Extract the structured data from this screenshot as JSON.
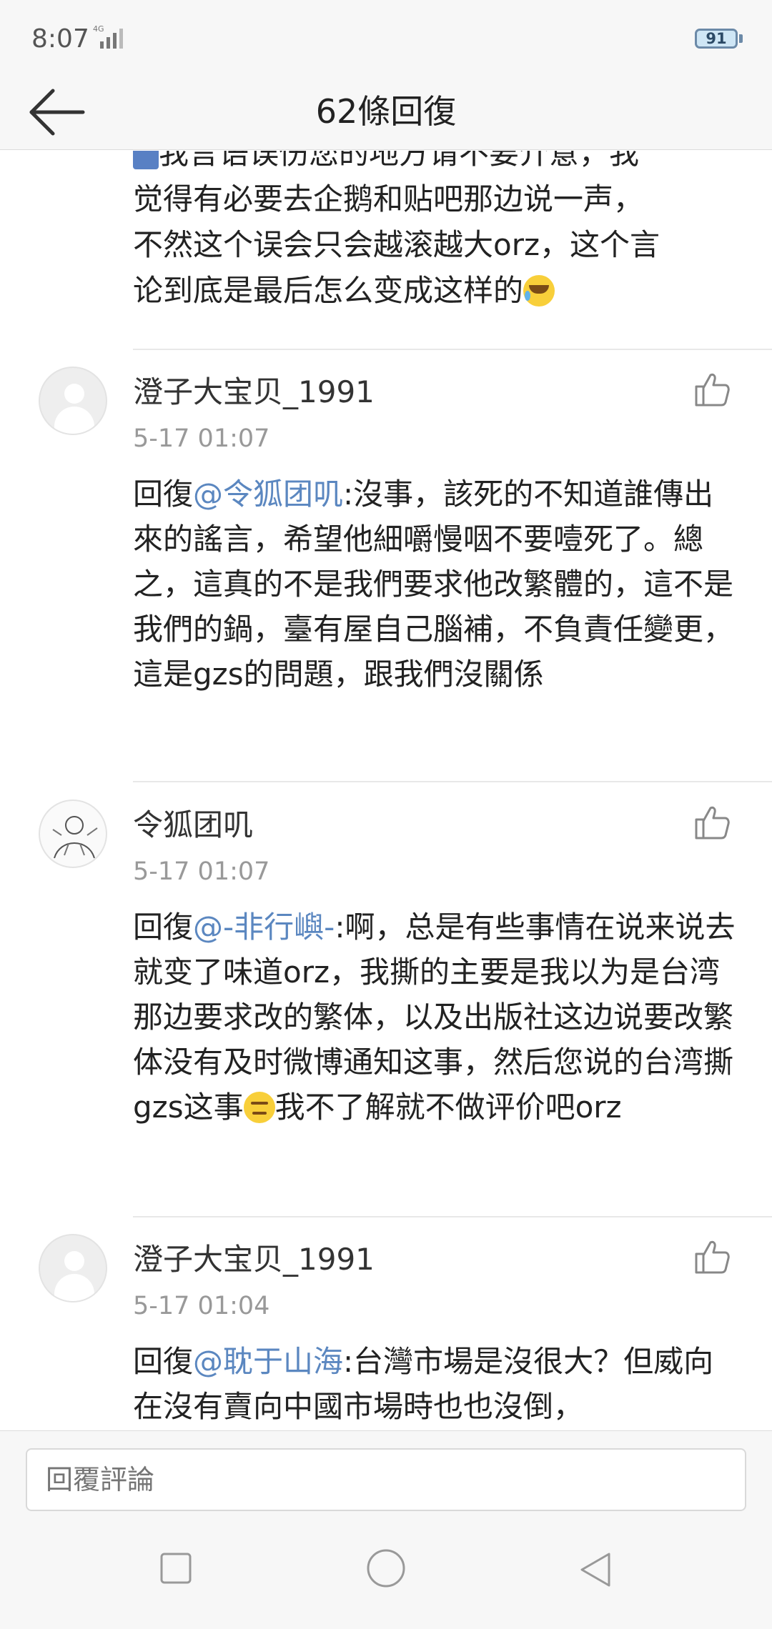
{
  "status_bar": {
    "time": "8:07",
    "network": "4G",
    "battery": "91"
  },
  "header": {
    "title": "62條回復",
    "back_icon": "arrow-left-icon"
  },
  "partial_comment": {
    "icon_start": "figure-emoji",
    "lines": [
      "我言语误伤您的地方请不要介意，我",
      "觉得有必要去企鹅和贴吧那边说一声，",
      "不然这个误会只会越滚越大orz，这个言",
      "论到底是最后怎么变成这样的"
    ],
    "icon_end": "crying-laughing-emoji"
  },
  "comments": [
    {
      "username": "澄子大宝贝_1991",
      "time": "5-17 01:07",
      "prefix": "回復",
      "mention": "@令狐团叽",
      "text": ":沒事，該死的不知道誰傳出來的謠言，希望他細嚼慢咽不要噎死了。總之，這真的不是我們要求他改繁體的，這不是我們的鍋，臺有屋自己腦補，不負責任變更，這是gzs的問題，跟我們沒關係",
      "avatar": "default-avatar"
    },
    {
      "username": "令狐团叽",
      "time": "5-17 01:07",
      "prefix": "回復",
      "mention": "@-非行嶼-",
      "text": ":啊，总是有些事情在说来说去就变了味道orz，我撕的主要是我以为是台湾那边要求改的繁体，以及出版社这边说要改繁体没有及时微博通知这事，然后您说的台湾撕gzs这事",
      "emoji": "smirk-emoji",
      "text_after": "我不了解就不做评价吧orz",
      "avatar": "sketch-avatar"
    },
    {
      "username": "澄子大宝贝_1991",
      "time": "5-17 01:04",
      "prefix": "回復",
      "mention": "@耽于山海",
      "text": ":台灣市場是沒很大？但威向在沒有賣向中國市場時也也沒倒，",
      "avatar": "default-avatar"
    }
  ],
  "reply_input": {
    "placeholder": "回覆評論"
  },
  "nav_bar": {
    "recents": "square-icon",
    "home": "circle-icon",
    "back": "triangle-back-icon"
  }
}
